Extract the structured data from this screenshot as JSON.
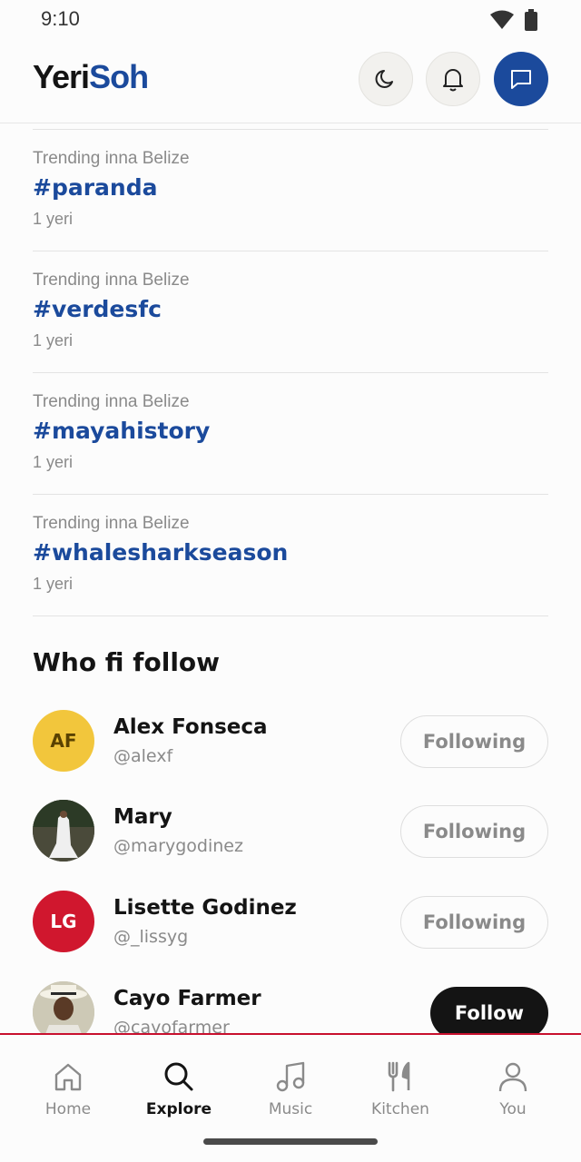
{
  "status": {
    "time": "9:10"
  },
  "header": {
    "logo_part1": "Yeri",
    "logo_part2": "Soh"
  },
  "trending": [
    {
      "context": "Trending inna Belize",
      "tag": "#paranda",
      "count": "1 yeri"
    },
    {
      "context": "Trending inna Belize",
      "tag": "#verdesfc",
      "count": "1 yeri"
    },
    {
      "context": "Trending inna Belize",
      "tag": "#mayahistory",
      "count": "1 yeri"
    },
    {
      "context": "Trending inna Belize",
      "tag": "#whalesharkseason",
      "count": "1 yeri"
    }
  ],
  "who_to_follow": {
    "title": "Who fi follow",
    "people": [
      {
        "initials": "AF",
        "name": "Alex Fonseca",
        "handle": "@alexf",
        "button": "Following"
      },
      {
        "initials": "",
        "name": "Mary",
        "handle": "@marygodinez",
        "button": "Following"
      },
      {
        "initials": "LG",
        "name": "Lisette Godinez",
        "handle": "@_lissyg",
        "button": "Following"
      },
      {
        "initials": "",
        "name": "Cayo Farmer",
        "handle": "@cayofarmer",
        "button": "Follow"
      }
    ]
  },
  "nav": {
    "items": [
      {
        "label": "Home",
        "icon": "home-icon"
      },
      {
        "label": "Explore",
        "icon": "search-icon"
      },
      {
        "label": "Music",
        "icon": "music-note-icon"
      },
      {
        "label": "Kitchen",
        "icon": "fork-knife-icon"
      },
      {
        "label": "You",
        "icon": "person-icon"
      }
    ],
    "active": "Explore"
  },
  "colors": {
    "brand_blue": "#1b4a9c",
    "accent_red": "#c8102e",
    "yellow_avatar": "#f2c63c",
    "red_avatar": "#d0172e"
  }
}
